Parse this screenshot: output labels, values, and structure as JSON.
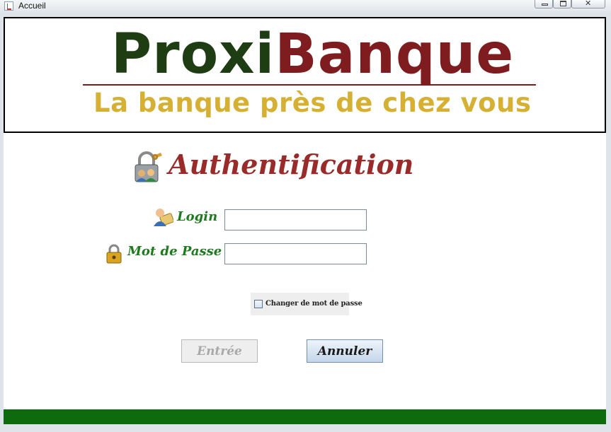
{
  "window": {
    "title": "Accueil",
    "icon": "java-cup-icon",
    "controls": [
      "minimize-icon",
      "maximize-icon",
      "close-icon"
    ]
  },
  "banner": {
    "brand_part1": "Proxi",
    "brand_part2": "Banque",
    "tagline": "La banque près de chez vous",
    "colors": {
      "proxi": "#1e3d12",
      "banque": "#7e1c1f",
      "tagline": "#d6b033"
    }
  },
  "auth": {
    "title": "Authentification",
    "icon": "lock-users-icon"
  },
  "form": {
    "login_label": "Login",
    "login_icon": "user-card-icon",
    "login_value": "",
    "password_label": "Mot de Passe",
    "password_icon": "padlock-icon",
    "password_value": "",
    "change_password_label": "Changer de mot de passe",
    "change_password_checked": false
  },
  "buttons": {
    "enter_label": "Entrée",
    "enter_enabled": false,
    "cancel_label": "Annuler"
  },
  "colors": {
    "footer": "#0d6b0d",
    "label_green": "#1e7a1e",
    "title_red": "#9a2b2b"
  }
}
